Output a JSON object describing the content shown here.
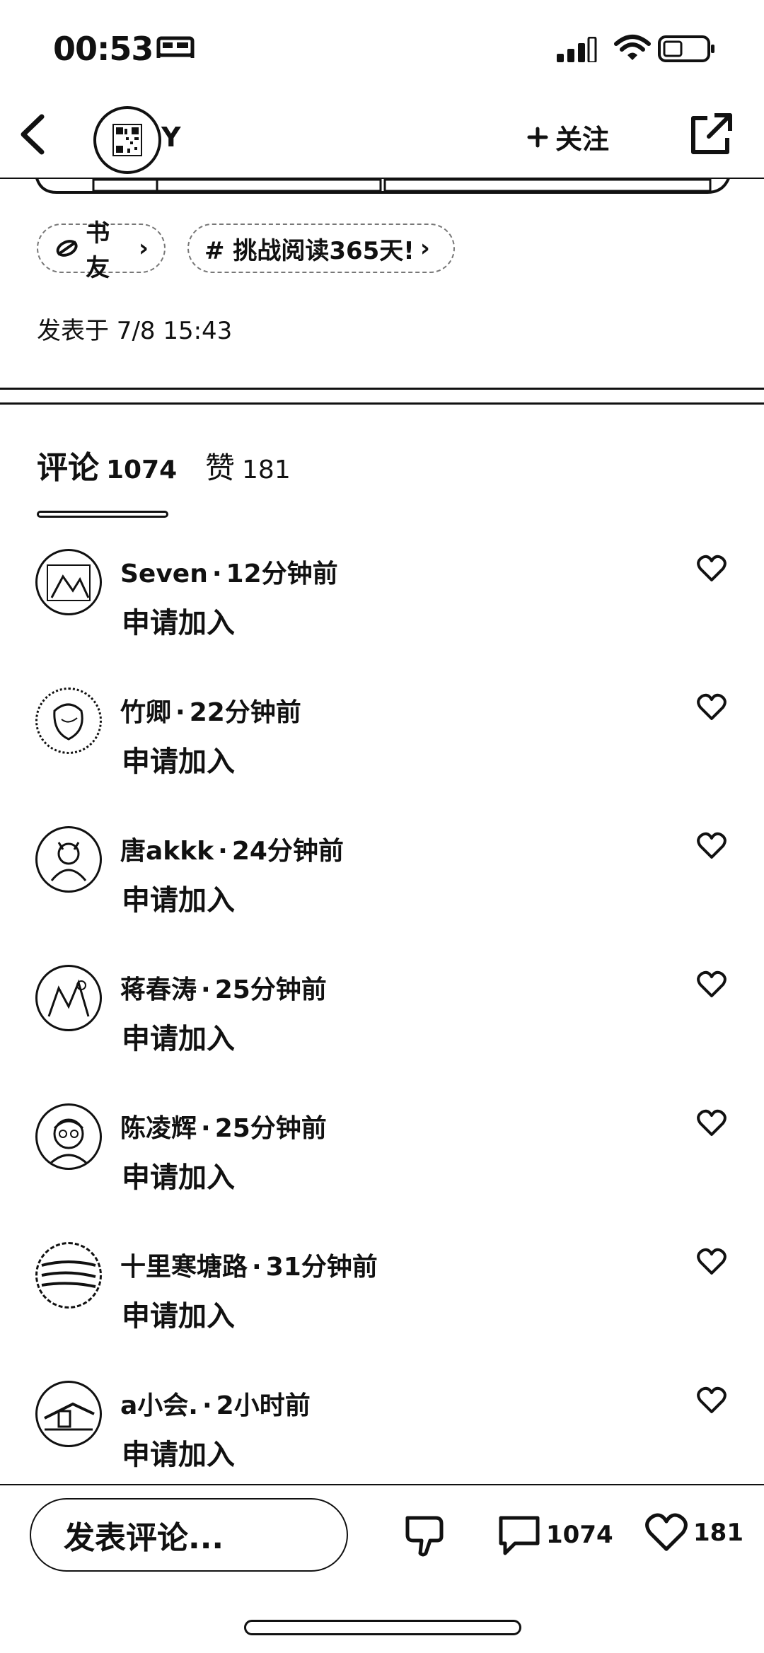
{
  "status_bar": {
    "time": "00:53"
  },
  "header": {
    "user_name": "Y",
    "follow_label": "关注"
  },
  "tags": [
    {
      "label": "书友",
      "arrow": "›"
    },
    {
      "label": "# 挑战阅读365天!",
      "arrow": "›"
    }
  ],
  "post": {
    "published": "发表于 7/8 15:43"
  },
  "tabs": {
    "comments": {
      "label": "评论",
      "count": "1074"
    },
    "likes": {
      "label": "赞",
      "count": "181"
    }
  },
  "comments": [
    {
      "name": "Seven",
      "time": "12分钟前",
      "text": "申请加入"
    },
    {
      "name": "竹卿",
      "time": "22分钟前",
      "text": "申请加入"
    },
    {
      "name": "唐akkk",
      "time": "24分钟前",
      "text": "申请加入"
    },
    {
      "name": "蒋春涛",
      "time": "25分钟前",
      "text": "申请加入"
    },
    {
      "name": "陈凌辉",
      "time": "25分钟前",
      "text": "申请加入"
    },
    {
      "name": "十里寒塘路",
      "time": "31分钟前",
      "text": "申请加入"
    },
    {
      "name": "a小会.",
      "time": "2小时前",
      "text": "申请加入"
    }
  ],
  "bottom_bar": {
    "input_placeholder": "发表评论...",
    "comment_count": "1074",
    "like_count": "181"
  }
}
